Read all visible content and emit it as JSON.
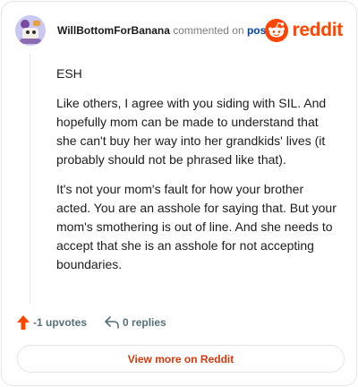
{
  "header": {
    "username": "WillBottomForBanana",
    "action_text": "commented on",
    "post_link": "post",
    "brand": "reddit"
  },
  "comment": {
    "paragraphs": [
      "ESH",
      "Like others, I agree with you siding with SIL. And hopefully mom can be made to understand that she can't buy her way into her grandkids' lives (it probably should not be phrased like that).",
      "It's not your mom's fault for how your brother acted. You are an asshole for saying that. But your mom's smothering is out of line. And she needs to accept that she is an asshole for not accepting boundaries."
    ]
  },
  "actions": {
    "upvotes": "-1 upvotes",
    "replies": "0 replies"
  },
  "footer": {
    "view_more": "View more on Reddit"
  },
  "colors": {
    "brand": "#ff4500",
    "link": "#0045ac",
    "view_more": "#d4380b"
  }
}
